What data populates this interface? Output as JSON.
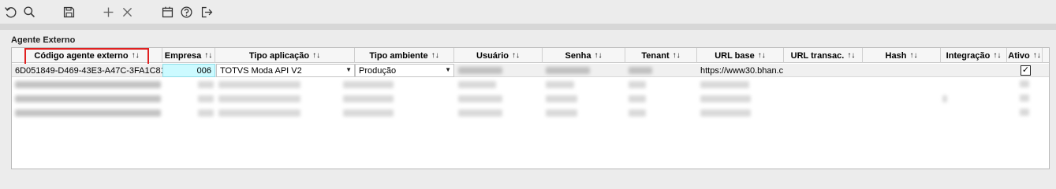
{
  "toolbar": {
    "icons": [
      "undo-icon",
      "search-icon",
      "save-icon",
      "add-icon",
      "delete-icon",
      "calendar-icon",
      "help-icon",
      "exit-icon"
    ]
  },
  "section": {
    "title": "Agente Externo"
  },
  "table": {
    "sort_glyph": "↑↓",
    "columns": [
      "Código agente externo",
      "Empresa",
      "Tipo aplicação",
      "Tipo ambiente",
      "Usuário",
      "Senha",
      "Tenant",
      "URL base",
      "URL transac.",
      "Hash",
      "Integração",
      "Ativo"
    ],
    "first_row": {
      "codigo": "6D051849-D469-43E3-A47C-3FA1C81",
      "empresa": "006",
      "tipo_aplicacao": "TOTVS Moda API V2",
      "tipo_ambiente": "Produção",
      "url_base": "https://www30.bhan.c",
      "ativo": true
    }
  }
}
